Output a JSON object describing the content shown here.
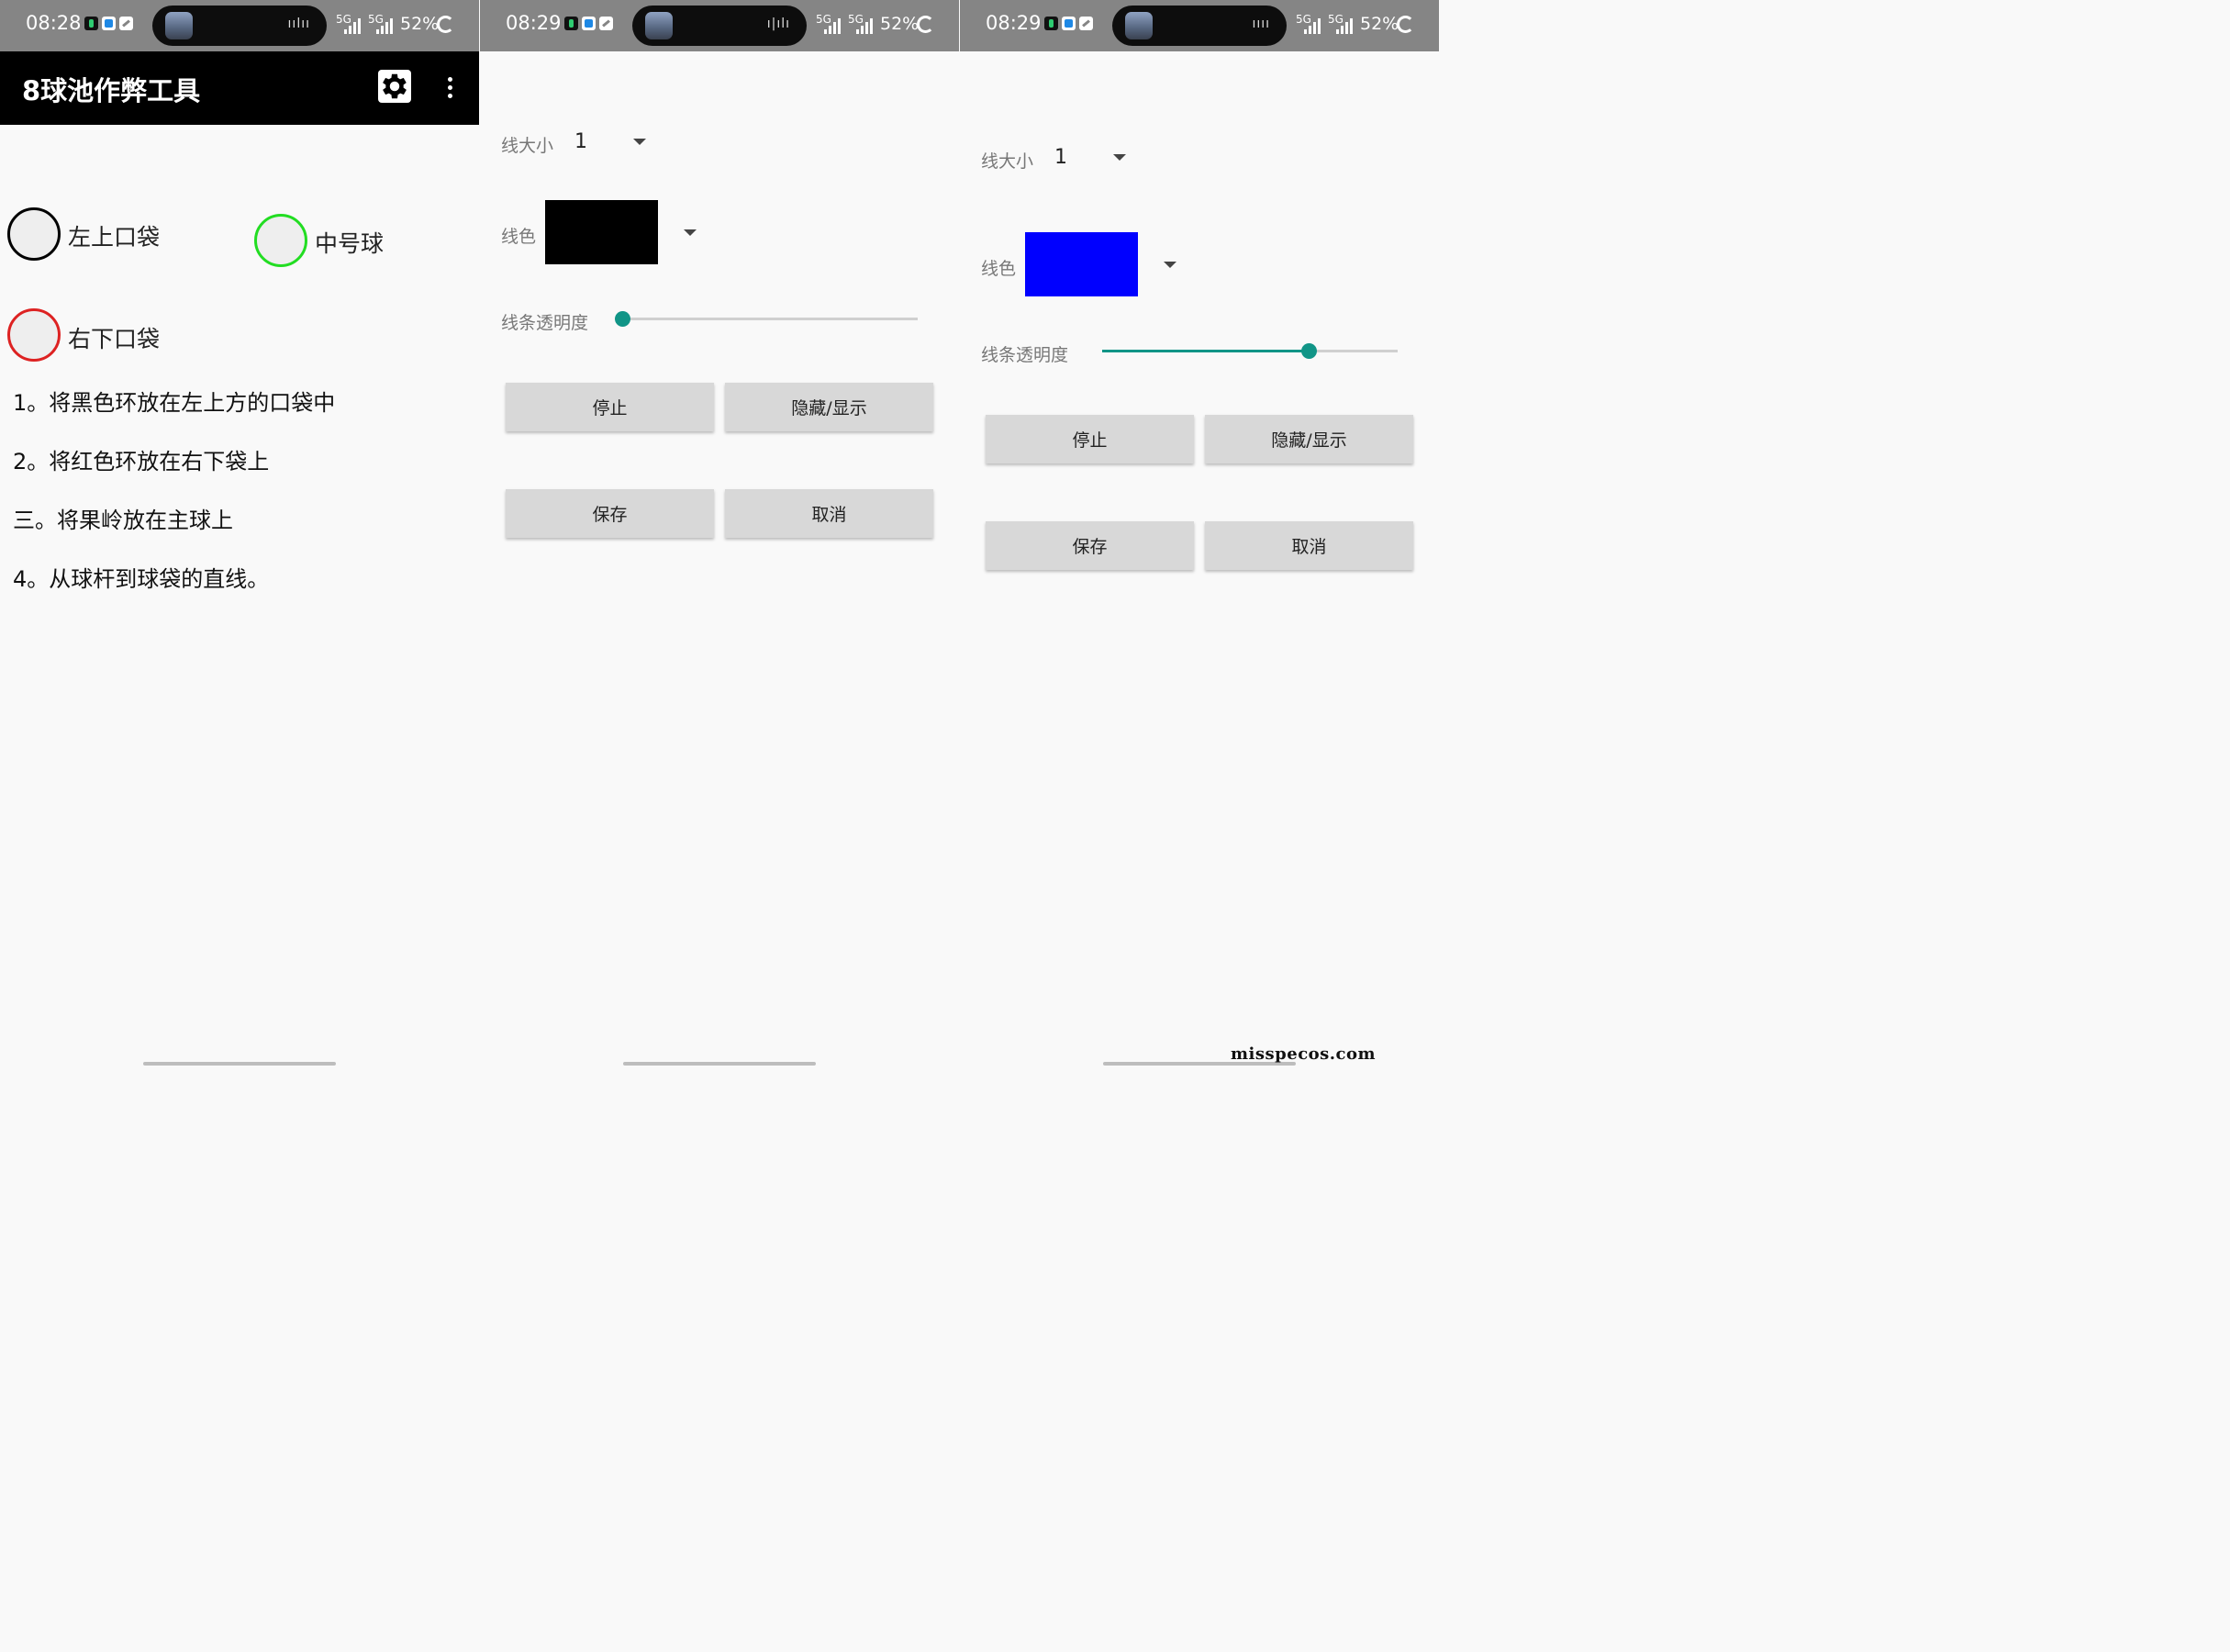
{
  "status_bars": [
    {
      "time": "08:28",
      "battery": "52%"
    },
    {
      "time": "08:29",
      "battery": "52%"
    },
    {
      "time": "08:29",
      "battery": "52%"
    }
  ],
  "network_label": "5G",
  "app": {
    "title": "8球池作弊工具"
  },
  "rings": [
    {
      "label": "左上口袋",
      "color": "#000000"
    },
    {
      "label": "中号球",
      "color": "#22dd22"
    },
    {
      "label": "右下口袋",
      "color": "#dd2222"
    }
  ],
  "instructions": [
    "1。将黑色环放在左上方的口袋中",
    "2。将红色环放在右下袋上",
    "三。将果岭放在主球上",
    "4。从球杆到球袋的直线。"
  ],
  "settings": {
    "line_size_label": "线大小",
    "line_color_label": "线色",
    "opacity_label": "线条透明度",
    "stop_label": "停止",
    "toggle_label": "隐藏/显示",
    "save_label": "保存",
    "cancel_label": "取消"
  },
  "panels": [
    {
      "line_size": "1",
      "line_color": "#000000",
      "opacity": 0.0
    },
    {
      "line_size": "1",
      "line_color": "#0000ff",
      "opacity": 0.7
    }
  ],
  "watermark": "misspecos.com"
}
